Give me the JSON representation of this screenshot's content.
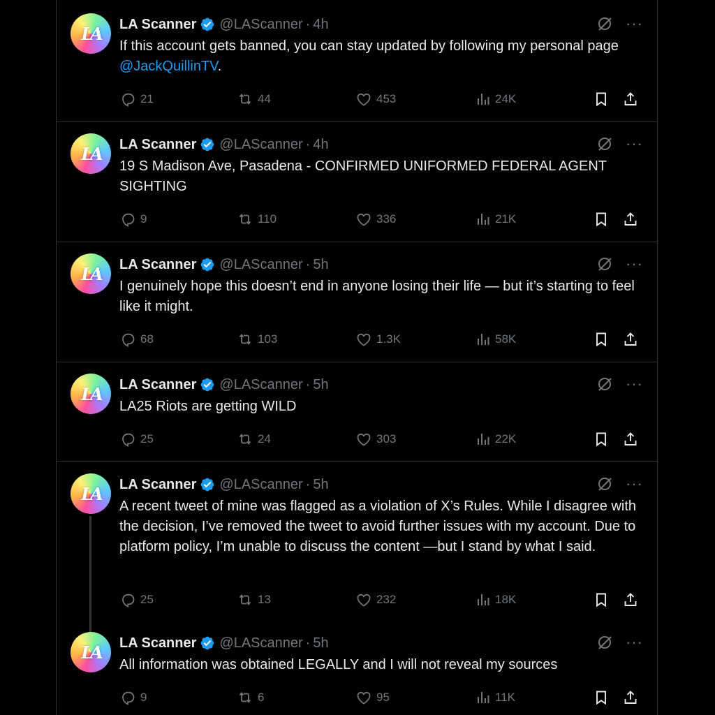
{
  "account": {
    "name": "LA Scanner",
    "handle": "@LAScanner",
    "separator": "·",
    "avatar_monogram": "LA"
  },
  "tweets": [
    {
      "time": "4h",
      "text": "If this account gets banned, you can stay updated by following my personal page ",
      "link": "@JackQuillinTV",
      "text_after": ".",
      "replies": "21",
      "reposts": "44",
      "likes": "453",
      "views": "24K"
    },
    {
      "time": "4h",
      "text": "19 S Madison Ave, Pasadena - CONFIRMED UNIFORMED FEDERAL AGENT SIGHTING",
      "replies": "9",
      "reposts": "110",
      "likes": "336",
      "views": "21K"
    },
    {
      "time": "5h",
      "text": "I genuinely hope this doesn’t end in anyone losing their life — but it’s starting to feel like it might.",
      "replies": "68",
      "reposts": "103",
      "likes": "1.3K",
      "views": "58K"
    },
    {
      "time": "5h",
      "text": "LA25 Riots are getting WILD",
      "replies": "25",
      "reposts": "24",
      "likes": "303",
      "views": "22K"
    },
    {
      "time": "5h",
      "text": "A recent tweet of mine was flagged as a violation of X’s Rules. While I disagree with the decision, I’ve removed the tweet to avoid further issues with my account. Due to platform policy, I’m unable to discuss the content —but I stand by what I said.",
      "replies": "25",
      "reposts": "13",
      "likes": "232",
      "views": "18K"
    },
    {
      "time": "5h",
      "text": "All information was obtained LEGALLY and I will not reveal my sources",
      "replies": "9",
      "reposts": "6",
      "likes": "95",
      "views": "11K"
    }
  ],
  "icons": [
    "reply-icon",
    "repost-icon",
    "like-icon",
    "views-icon",
    "bookmark-icon",
    "share-icon",
    "verified-badge-icon",
    "grok-icon",
    "more-icon"
  ],
  "colors": {
    "background": "#000000",
    "text": "#e7e9ea",
    "muted": "#71767b",
    "link": "#1d9bf0",
    "verified": "#1d9bf0",
    "divider": "#2f3336"
  }
}
